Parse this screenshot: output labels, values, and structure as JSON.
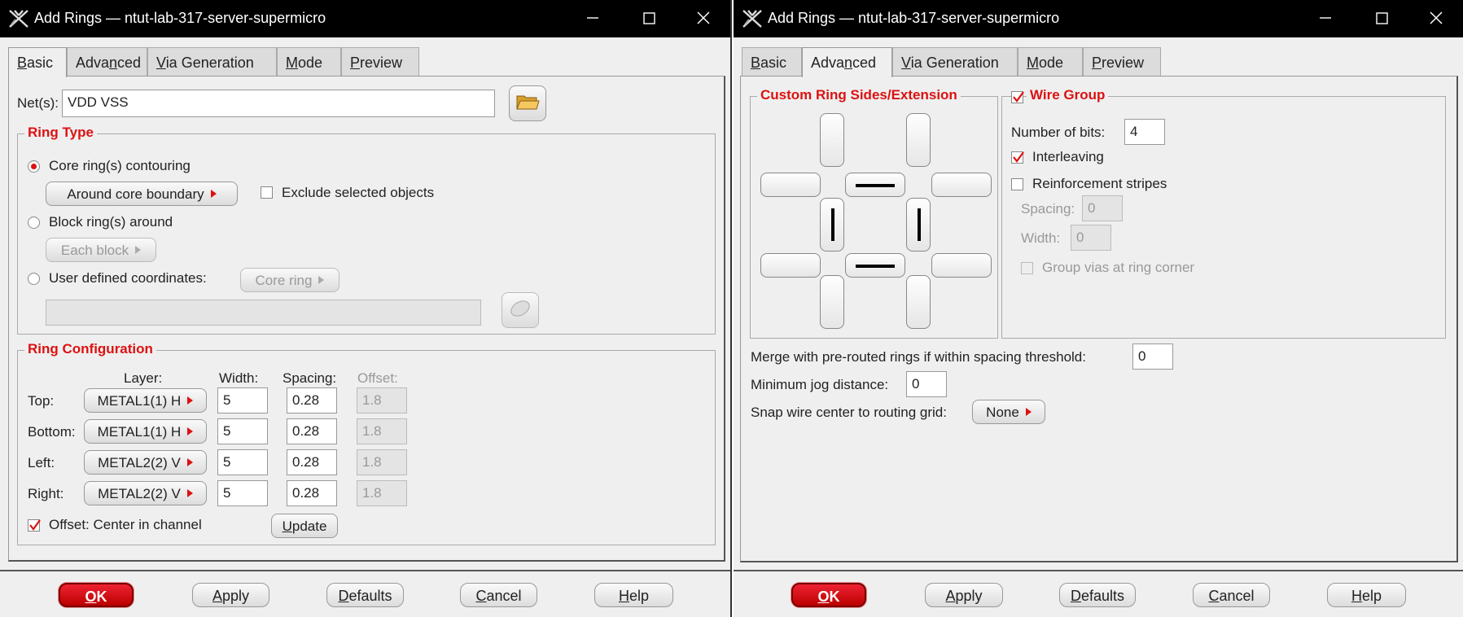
{
  "left": {
    "title": "Add Rings — ntut-lab-317-server-supermicro",
    "tabs": [
      {
        "pre": "",
        "u": "B",
        "post": "asic"
      },
      {
        "pre": "Adva",
        "u": "n",
        "post": "ced"
      },
      {
        "pre": "",
        "u": "V",
        "post": "ia Generation"
      },
      {
        "pre": "",
        "u": "M",
        "post": "ode"
      },
      {
        "pre": "",
        "u": "P",
        "post": "review"
      }
    ],
    "nets_label": "Net(s):",
    "nets_value": "VDD VSS",
    "ring_type": {
      "title": "Ring Type",
      "core_label": "Core ring(s) contouring",
      "core_btn": "Around core boundary",
      "exclude_label": "Exclude selected objects",
      "block_label": "Block ring(s) around",
      "block_btn": "Each block",
      "user_label": "User defined coordinates:",
      "user_btn": "Core ring",
      "coords_value": ""
    },
    "ring_config": {
      "title": "Ring Configuration",
      "headers": {
        "layer": "Layer:",
        "width": "Width:",
        "spacing": "Spacing:",
        "offset": "Offset:"
      },
      "rows": [
        {
          "label": "Top:",
          "layer": "METAL1(1) H",
          "width": "5",
          "spacing": "0.28",
          "offset": "1.8"
        },
        {
          "label": "Bottom:",
          "layer": "METAL1(1) H",
          "width": "5",
          "spacing": "0.28",
          "offset": "1.8"
        },
        {
          "label": "Left:",
          "layer": "METAL2(2) V",
          "width": "5",
          "spacing": "0.28",
          "offset": "1.8"
        },
        {
          "label": "Right:",
          "layer": "METAL2(2) V",
          "width": "5",
          "spacing": "0.28",
          "offset": "1.8"
        }
      ],
      "offset_center_label": "Offset: Center in channel",
      "update_btn": {
        "pre": "",
        "u": "U",
        "post": "pdate"
      }
    },
    "buttons": {
      "ok": {
        "pre": "",
        "u": "O",
        "post": "K"
      },
      "apply": {
        "pre": "",
        "u": "A",
        "post": "pply"
      },
      "defaults": {
        "pre": "",
        "u": "D",
        "post": "efaults"
      },
      "cancel": {
        "pre": "",
        "u": "C",
        "post": "ancel"
      },
      "help": {
        "pre": "",
        "u": "H",
        "post": "elp"
      }
    }
  },
  "right": {
    "title": "Add Rings — ntut-lab-317-server-supermicro",
    "tabs": [
      {
        "pre": "",
        "u": "B",
        "post": "asic"
      },
      {
        "pre": "Adva",
        "u": "n",
        "post": "ced"
      },
      {
        "pre": "",
        "u": "V",
        "post": "ia Generation"
      },
      {
        "pre": "",
        "u": "M",
        "post": "ode"
      },
      {
        "pre": "",
        "u": "P",
        "post": "review"
      }
    ],
    "custom_sides_title": "Custom Ring Sides/Extension",
    "wire_group": {
      "title": "Wire Group",
      "bits_label": "Number of bits:",
      "bits_value": "4",
      "interleaving_label": "Interleaving",
      "reinforcement_label": "Reinforcement stripes",
      "spacing_label": "Spacing:",
      "spacing_value": "0",
      "width_label": "Width:",
      "width_value": "0",
      "group_vias_label": "Group vias at ring corner"
    },
    "merge_label": "Merge with pre-routed rings if within spacing threshold:",
    "merge_value": "0",
    "jog_label": "Minimum jog distance:",
    "jog_value": "0",
    "snap_label": "Snap wire center to routing grid:",
    "snap_value": "None",
    "buttons": {
      "ok": {
        "pre": "",
        "u": "O",
        "post": "K"
      },
      "apply": {
        "pre": "",
        "u": "A",
        "post": "pply"
      },
      "defaults": {
        "pre": "",
        "u": "D",
        "post": "efaults"
      },
      "cancel": {
        "pre": "",
        "u": "C",
        "post": "ancel"
      },
      "help": {
        "pre": "",
        "u": "H",
        "post": "elp"
      }
    }
  }
}
